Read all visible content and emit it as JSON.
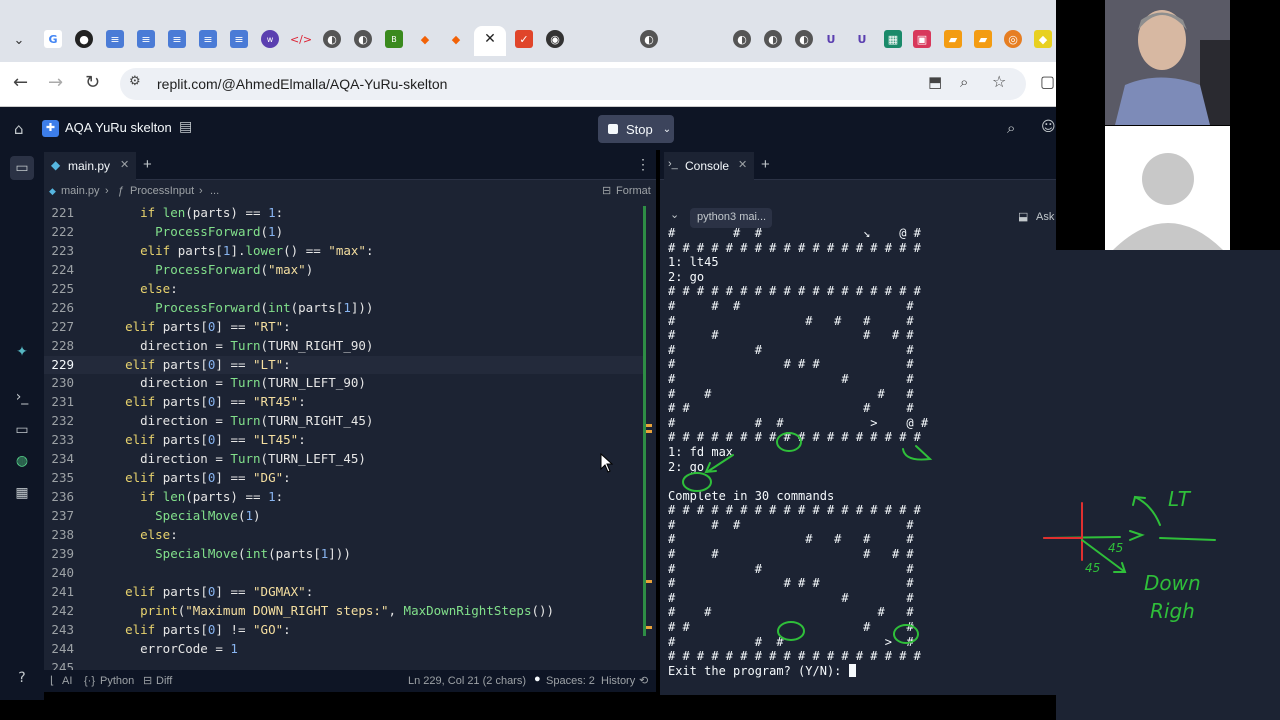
{
  "browser": {
    "url": "replit.com/@AhmedElmalla/AQA-YuRu-skelton",
    "close_tab_glyph": "✕"
  },
  "replit": {
    "app_title": "AQA YuRu skelton",
    "stop_label": "Stop"
  },
  "editor": {
    "tab_label": "main.py",
    "breadcrumb_file": "main.py",
    "breadcrumb_func": "ProcessInput",
    "breadcrumb_more": "...",
    "format_label": "Format",
    "lines": [
      {
        "n": "221",
        "t": "    if len(parts) == 1:"
      },
      {
        "n": "222",
        "t": "      ProcessForward(1)"
      },
      {
        "n": "223",
        "t": "    elif parts[1].lower() == \"max\":"
      },
      {
        "n": "224",
        "t": "      ProcessForward(\"max\")"
      },
      {
        "n": "225",
        "t": "    else:"
      },
      {
        "n": "226",
        "t": "      ProcessForward(int(parts[1]))"
      },
      {
        "n": "227",
        "t": "  elif parts[0] == \"RT\":"
      },
      {
        "n": "228",
        "t": "    direction = Turn(TURN_RIGHT_90)"
      },
      {
        "n": "229",
        "t": "  elif parts[0] == \"LT\":"
      },
      {
        "n": "230",
        "t": "    direction = Turn(TURN_LEFT_90)"
      },
      {
        "n": "231",
        "t": "  elif parts[0] == \"RT45\":"
      },
      {
        "n": "232",
        "t": "    direction = Turn(TURN_RIGHT_45)"
      },
      {
        "n": "233",
        "t": "  elif parts[0] == \"LT45\":"
      },
      {
        "n": "234",
        "t": "    direction = Turn(TURN_LEFT_45)"
      },
      {
        "n": "235",
        "t": "  elif parts[0] == \"DG\":"
      },
      {
        "n": "236",
        "t": "    if len(parts) == 1:"
      },
      {
        "n": "237",
        "t": "      SpecialMove(1)"
      },
      {
        "n": "238",
        "t": "    else:"
      },
      {
        "n": "239",
        "t": "      SpecialMove(int(parts[1]))"
      },
      {
        "n": "240",
        "t": ""
      },
      {
        "n": "241",
        "t": "  elif parts[0] == \"DGMAX\":"
      },
      {
        "n": "242",
        "t": "    print(\"Maximum DOWN_RIGHT steps:\", MaxDownRightSteps())"
      },
      {
        "n": "243",
        "t": "  elif parts[0] != \"GO\":"
      },
      {
        "n": "244",
        "t": "    errorCode = 1"
      },
      {
        "n": "245",
        "t": ""
      }
    ],
    "active_line": "229",
    "status": {
      "ai": "AI",
      "language": "Python",
      "diff": "Diff",
      "position": "Ln 229, Col 21 (2 chars)",
      "spaces": "Spaces: 2",
      "history": "History"
    }
  },
  "console": {
    "tab_label": "Console",
    "pill_label": "python3 mai...",
    "ask_label": "Ask",
    "lines": [
      "#        #  #              ↘    @ #",
      "# # # # # # # # # # # # # # # # # #",
      "1: lt45",
      "2: go",
      "# # # # # # # # # # # # # # # # # #",
      "#     #  #                       #",
      "#                  #   #   #     #",
      "#     #                    #   # #",
      "#           #                    #",
      "#               # # #            #",
      "#                       #        #",
      "#    #                       #   #",
      "# #                        #     #",
      "#           #  #            >    @ #",
      "# # # # # # # # # # # # # # # # # #",
      "1: fd max",
      "2: go",
      "",
      "Complete in 30 commands",
      "# # # # # # # # # # # # # # # # # #",
      "#     #  #                       #",
      "#                  #   #   #     #",
      "#     #                    #   # #",
      "#           #                    #",
      "#               # # #            #",
      "#                       #        #",
      "#    #                       #   #",
      "# #                        #     #",
      "#           #  #              >  #",
      "# # # # # # # # # # # # # # # # # #",
      "Exit the program? (Y/N): "
    ]
  },
  "annotations": {
    "lt_text": "LT",
    "down_text": "Down",
    "right_text": "Righ",
    "angle1": "45",
    "angle2": "45",
    "ink_color": "#2fbf3a"
  }
}
